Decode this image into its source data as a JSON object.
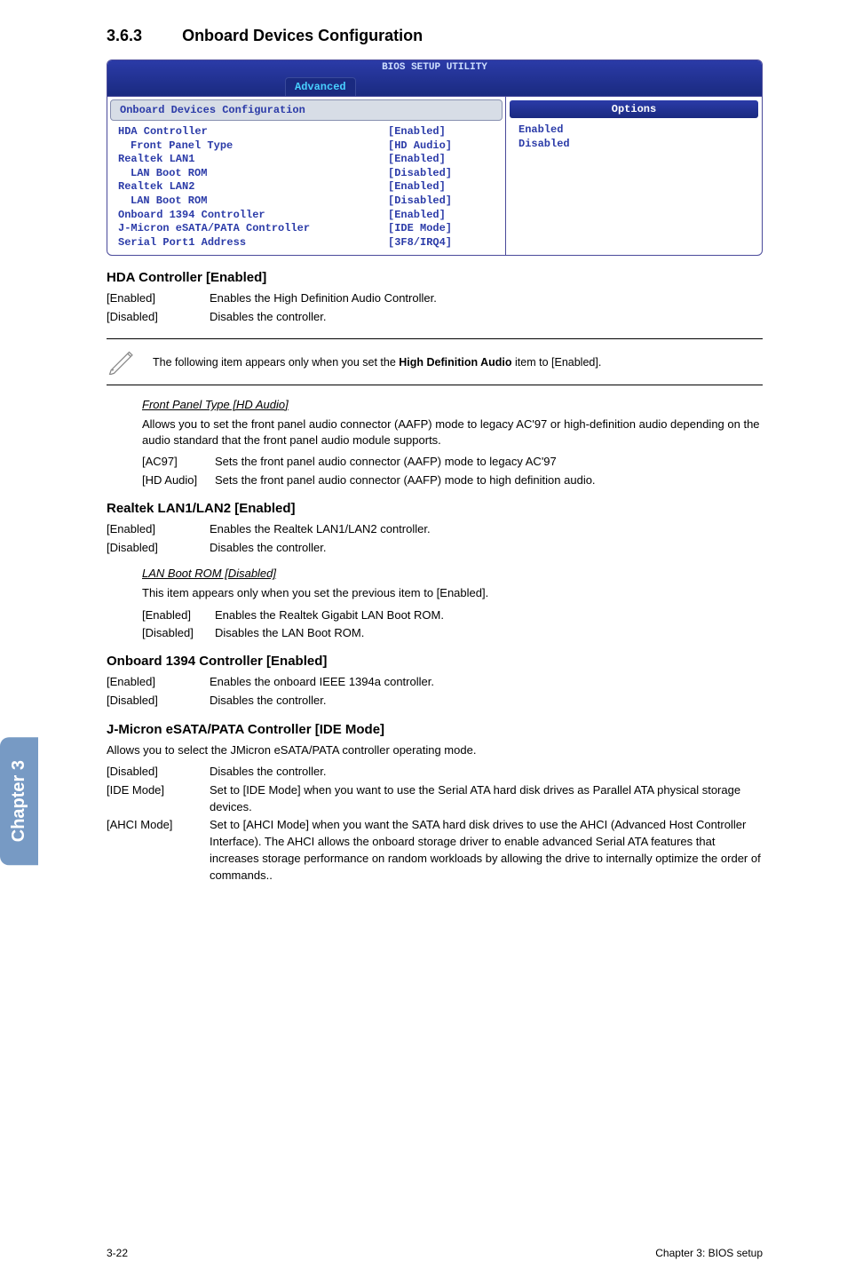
{
  "section": {
    "number": "3.6.3",
    "title": "Onboard Devices Configuration"
  },
  "bios": {
    "title": "BIOS SETUP UTILITY",
    "tab": "Advanced",
    "subheader": "Onboard Devices Configuration",
    "rows": [
      {
        "label": "HDA Controller",
        "value": "[Enabled]",
        "indent": false
      },
      {
        "label": "Front Panel Type",
        "value": "[HD Audio]",
        "indent": true
      },
      {
        "label": "Realtek LAN1",
        "value": "[Enabled]",
        "indent": false
      },
      {
        "label": "LAN Boot ROM",
        "value": "[Disabled]",
        "indent": true
      },
      {
        "label": "Realtek LAN2",
        "value": "[Enabled]",
        "indent": false
      },
      {
        "label": "LAN Boot ROM",
        "value": "[Disabled]",
        "indent": true
      },
      {
        "label": "Onboard 1394 Controller",
        "value": "[Enabled]",
        "indent": false
      },
      {
        "label": "J-Micron eSATA/PATA Controller",
        "value": "[IDE Mode]",
        "indent": false
      },
      {
        "label": "Serial Port1 Address",
        "value": "[3F8/IRQ4]",
        "indent": false
      }
    ],
    "options_header": "Options",
    "options": [
      "Enabled",
      "Disabled"
    ]
  },
  "hda": {
    "heading": "HDA Controller [Enabled]",
    "r1_term": "[Enabled]",
    "r1_desc": "Enables the High Definition Audio Controller.",
    "r2_term": "[Disabled]",
    "r2_desc": "Disables the controller."
  },
  "note": {
    "prefix": "The following item appears only when you set the ",
    "bold": "High Definition Audio",
    "suffix": " item to [Enabled]."
  },
  "fpt": {
    "heading": "Front Panel Type [HD Audio]",
    "para": "Allows you to set the front panel audio connector (AAFP) mode to legacy AC'97 or high-definition audio depending on the audio standard that the front panel audio module supports.",
    "r1_term": "[AC97]",
    "r1_desc": "Sets the front panel audio connector (AAFP) mode to legacy AC'97",
    "r2_term": "[HD Audio]",
    "r2_desc": "Sets the front panel audio connector (AAFP) mode to high definition audio."
  },
  "realtek": {
    "heading": "Realtek LAN1/LAN2 [Enabled]",
    "r1_term": "[Enabled]",
    "r1_desc": "Enables the Realtek LAN1/LAN2 controller.",
    "r2_term": "[Disabled]",
    "r2_desc": "Disables the controller."
  },
  "lanboot": {
    "heading": "LAN Boot ROM [Disabled]",
    "para": "This item appears only when you set the previous item to [Enabled].",
    "r1_term": "[Enabled]",
    "r1_desc": "Enables the Realtek Gigabit LAN Boot ROM.",
    "r2_term": "[Disabled]",
    "r2_desc": "Disables the LAN Boot ROM."
  },
  "onboard1394": {
    "heading": "Onboard 1394 Controller [Enabled]",
    "r1_term": "[Enabled]",
    "r1_desc": "Enables the onboard IEEE 1394a controller.",
    "r2_term": "[Disabled]",
    "r2_desc": "Disables the controller."
  },
  "jmicron": {
    "heading": "J-Micron eSATA/PATA Controller [IDE Mode]",
    "para": "Allows you to select the JMicron eSATA/PATA controller operating mode.",
    "r1_term": "[Disabled]",
    "r1_desc": "Disables the controller.",
    "r2_term": "[IDE Mode]",
    "r2_desc": "Set to [IDE Mode] when you want to use the Serial ATA hard disk drives as Parallel ATA physical storage devices.",
    "r3_term": "[AHCI Mode]",
    "r3_desc": "Set to [AHCI Mode] when you want the SATA hard disk drives to use the AHCI (Advanced Host Controller Interface). The AHCI allows the onboard storage driver to enable advanced Serial ATA features that increases storage performance on random workloads by allowing the drive to internally optimize the order of commands.."
  },
  "chapter_tab": "Chapter 3",
  "footer": {
    "left": "3-22",
    "right": "Chapter 3: BIOS setup"
  }
}
